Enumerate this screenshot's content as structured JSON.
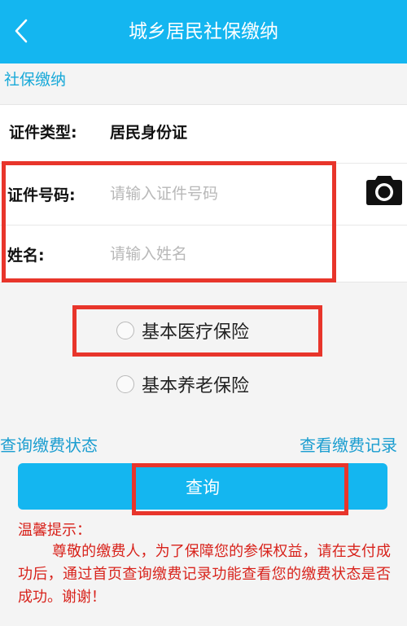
{
  "header": {
    "title": "城乡居民社保缴纳",
    "back_icon": "chevron-left-icon"
  },
  "section": {
    "label": "社保缴纳"
  },
  "form": {
    "id_type_label": "证件类型:",
    "id_type_value": "居民身份证",
    "id_number_label": "证件号码:",
    "id_number_value": "",
    "id_number_placeholder": "请输入证件号码",
    "name_label": "姓名:",
    "name_value": "",
    "name_placeholder": "请输入姓名",
    "camera_icon": "camera-icon"
  },
  "insurance_options": [
    {
      "label": "基本医疗保险",
      "selected": false
    },
    {
      "label": "基本养老保险",
      "selected": false
    }
  ],
  "links": {
    "query_status": "查询缴费状态",
    "view_records": "查看缴费记录"
  },
  "query_button": {
    "label": "查询"
  },
  "tips": {
    "title": "温馨提示：",
    "body": "尊敬的缴费人，为了保障您的参保权益，请在支付成功后，通过首页查询缴费记录功能查看您的缴费状态是否成功。谢谢！"
  },
  "colors": {
    "brand": "#14b6f0",
    "link": "#1a9dd0",
    "highlight": "#e8352b",
    "tip_text": "#d8231c"
  }
}
